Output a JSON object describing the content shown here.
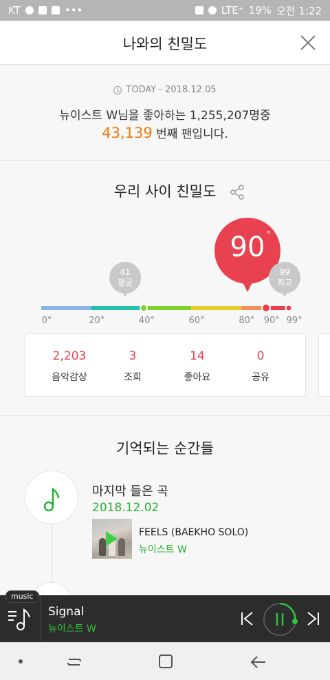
{
  "status_bar": {
    "carrier": "KT",
    "battery": "19%",
    "time": "오전 1:22",
    "network": "LTE⁺"
  },
  "header": {
    "title": "나와의 친밀도"
  },
  "rank": {
    "date": "TODAY - 2018.12.05",
    "line1": "뉴이스트 W님을 좋아하는 1,255,207명중",
    "rank_number": "43,139",
    "line2_suffix": "번째 팬입니다."
  },
  "intimacy": {
    "title": "우리 사이 친밀도",
    "value": "90",
    "degree": "°",
    "average_value": "41",
    "average_label": "평균",
    "max_value": "99",
    "max_label": "최고",
    "scale": {
      "min": 0,
      "max": 99,
      "user": 90,
      "average": 41,
      "max_score": 99
    },
    "ticks": [
      "0°",
      "20°",
      "40°",
      "60°",
      "80°",
      "90°",
      "99°"
    ],
    "segment_colors": [
      "#8ab5ea",
      "#23c1a8",
      "#7fd02a",
      "#e6cf2a",
      "#f3905a",
      "#e84250"
    ],
    "accent_color": "#e84250"
  },
  "stats": [
    {
      "value": "2,203",
      "label": "음악감상"
    },
    {
      "value": "3",
      "label": "조회"
    },
    {
      "value": "14",
      "label": "좋아요"
    },
    {
      "value": "0",
      "label": "공유"
    }
  ],
  "moments": {
    "title": "기억되는 순간들",
    "item_title": "마지막 들은 곡",
    "item_date": "2018.12.02",
    "song": "FEELS (BAEKHO SOLO)",
    "artist": "뉴이스트 W"
  },
  "player": {
    "tag": "music",
    "track": "Signal",
    "artist": "뉴이스트 W"
  }
}
